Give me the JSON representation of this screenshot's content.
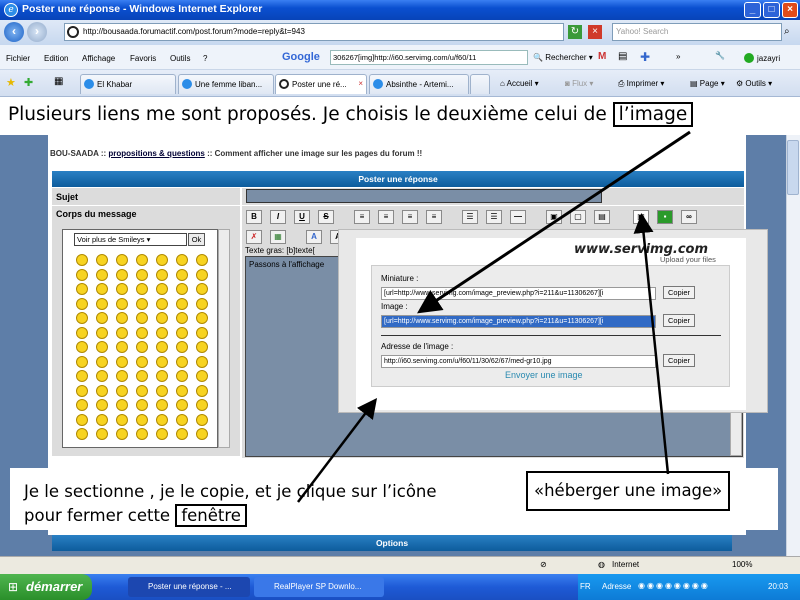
{
  "window": {
    "title": "Poster une réponse - Windows Internet Explorer"
  },
  "address": {
    "url": "http://bousaada.forumactif.com/post.forum?mode=reply&t=943",
    "search_placeholder": "Yahoo! Search"
  },
  "menu": {
    "items": [
      "Fichier",
      "Edition",
      "Affichage",
      "Favoris",
      "Outils",
      "?"
    ],
    "google_text": "306267[img]http://i60.servimg.com/u/f60/11",
    "rechercher": "Rechercher",
    "user": "jazayri"
  },
  "tabs": [
    {
      "label": "El Khabar"
    },
    {
      "label": "Une femme liban..."
    },
    {
      "label": "Poster une ré..."
    },
    {
      "label": "Absinthe - Artemi..."
    }
  ],
  "toolbar_right": {
    "accueil": "Accueil",
    "flux": "Flux",
    "imprimer": "Imprimer",
    "page": "Page",
    "outils": "Outils"
  },
  "captions": {
    "top_prefix": "Plusieurs liens me sont proposés. Je choisis le deuxième celui de ",
    "top_boxed": "l’image",
    "bottom_line1": "Je le sectionne , je le copie, et je clique sur l’icône",
    "bottom_boxed": "«héberger une image»",
    "bottom_line2": "pour fermer cette ",
    "bottom_boxed2": "fenêtre"
  },
  "forum": {
    "breadcrumb_site": "BOU-SAADA",
    "breadcrumb_sep": "::",
    "breadcrumb_cat": "propositions & questions",
    "breadcrumb_topic": ":: Comment afficher une image sur les pages du forum !!",
    "post_title": "Poster une réponse",
    "sujet_label": "Sujet",
    "corps_label": "Corps du message",
    "smiley_select": "Voir plus de Smileys",
    "ok": "Ok",
    "textarea_hint": "Texte gras: [b]texte[",
    "textarea_content": "Passons à l'affichage",
    "options_label": "Options"
  },
  "popup": {
    "logo": "www.servimg.com",
    "tagline": "Upload your files",
    "miniature_label": "Miniature :",
    "miniature_value": "[url=http://www.servimg.com/image_preview.php?i=211&u=11306267][i",
    "image_label": "Image :",
    "image_value": "[url=http://www.servimg.com/image_preview.php?i=211&u=11306267][i",
    "adresse_label": "Adresse de l'image :",
    "adresse_value": "http://i60.servimg.com/u/f60/11/30/62/67/med-gr10.jpg",
    "copier": "Copier",
    "envoyer": "Envoyer une image"
  },
  "status": {
    "zone": "Internet",
    "zoom": "100%"
  },
  "taskbar": {
    "start": "démarrer",
    "tasks": [
      "Poster une réponse - ...",
      "RealPlayer SP Downlo..."
    ],
    "lang": "FR",
    "adresse": "Adresse",
    "clock": "20:03"
  },
  "colors": {
    "forum_bg": "#5e7ea8",
    "blue_bar": "#1a6bb0",
    "taskbar": "#245edb",
    "start_green": "#3aa33a"
  }
}
